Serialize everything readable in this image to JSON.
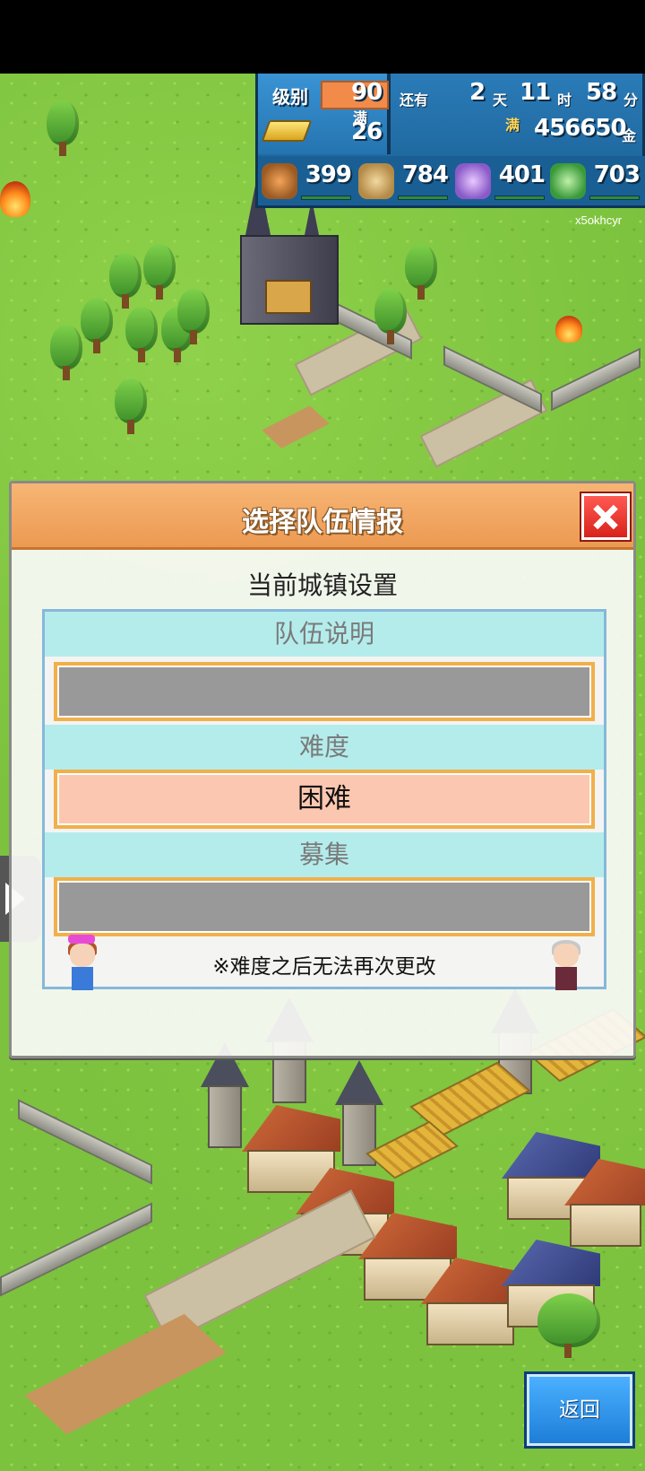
{
  "hud": {
    "level_label": "级别",
    "level_value": "90",
    "full_label": "满",
    "full_value": "26",
    "remaining_label": "还有",
    "days_value": "2",
    "days_unit": "天",
    "hours_value": "11",
    "hours_unit": "时",
    "minutes_value": "58",
    "minutes_unit": "分",
    "gold_prefix": "满",
    "gold_value": "456650",
    "gold_unit": "金",
    "stats": [
      {
        "icon": "food-icon",
        "value": "399"
      },
      {
        "icon": "materials-bag-icon",
        "value": "784"
      },
      {
        "icon": "music-note-icon",
        "value": "401"
      },
      {
        "icon": "book-icon",
        "value": "703"
      }
    ]
  },
  "watermark": "x5okhcyr",
  "dialog": {
    "title": "选择队伍情报",
    "subtitle": "当前城镇设置",
    "sections": {
      "team_description": {
        "label": "队伍说明",
        "value": ""
      },
      "difficulty": {
        "label": "难度",
        "value": "困难"
      },
      "recruit": {
        "label": "募集",
        "value": ""
      }
    },
    "notice": "※难度之后无法再次更改"
  },
  "back_button": "返回",
  "colors": {
    "header_orange": "#ec9a52",
    "section_cyan": "#b4ecec",
    "difficulty_fill": "#fcc7b0",
    "close_red": "#d8221a",
    "back_blue": "#1e7ed8",
    "hud_blue": "#1a5f93"
  }
}
